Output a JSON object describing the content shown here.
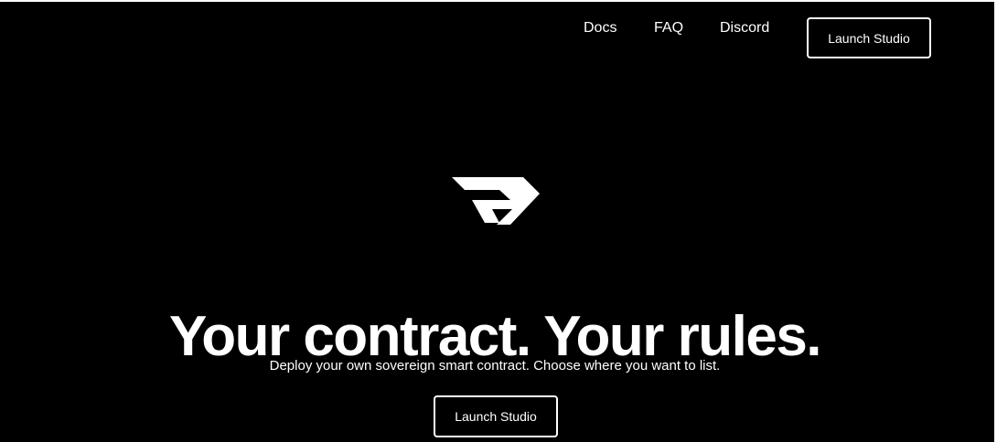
{
  "nav": {
    "links": [
      "Docs",
      "FAQ",
      "Discord"
    ],
    "cta_label": "Launch Studio"
  },
  "hero": {
    "logo_icon": "stylized-r-logo-icon",
    "headline": "Your contract. Your rules.",
    "subheadline": "Deploy your own sovereign smart contract. Choose where you want to list.",
    "cta_label": "Launch Studio"
  },
  "colors": {
    "background": "#000000",
    "foreground": "#ffffff"
  }
}
